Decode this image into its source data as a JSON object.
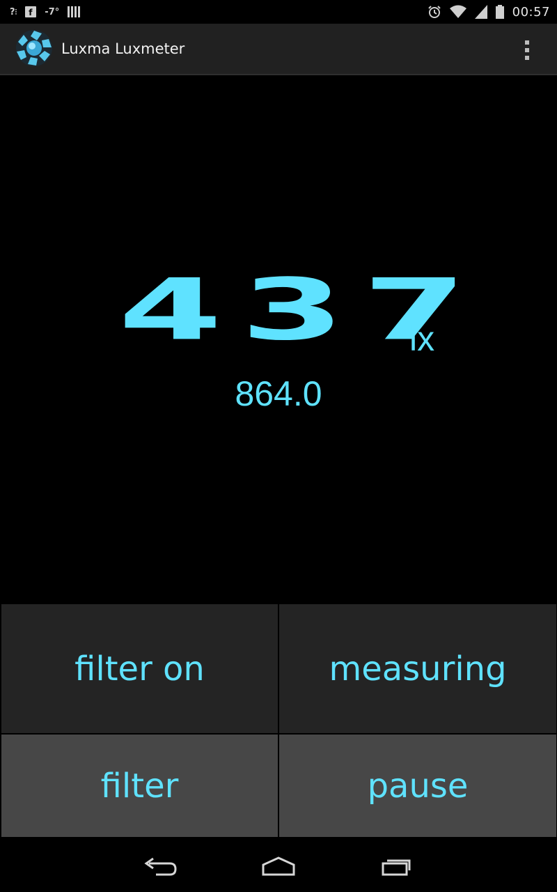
{
  "status_bar": {
    "left_icons": [
      "signal-unknown-icon",
      "facebook-icon",
      "temperature-text",
      "barcode-icon"
    ],
    "temperature": "-7°",
    "right_icons": [
      "alarm-icon",
      "wifi-icon",
      "cell-signal-icon",
      "battery-icon"
    ],
    "time": "00:57"
  },
  "action_bar": {
    "app_icon": "luxma-aperture-icon",
    "title": "Luxma Luxmeter",
    "overflow_icon": "overflow-menu-icon"
  },
  "reading": {
    "value": "437",
    "unit": "lx",
    "raw": "864.0"
  },
  "buttons": {
    "filter_status": "filter on",
    "measure_status": "measuring",
    "filter": "filter",
    "pause": "pause"
  },
  "nav_bar": {
    "icons": [
      "back-icon",
      "home-icon",
      "recent-apps-icon"
    ]
  },
  "colors": {
    "accent": "#5fe2ff",
    "action_bar_bg": "#212121",
    "button_dark": "#242424",
    "button_light": "#474747"
  }
}
